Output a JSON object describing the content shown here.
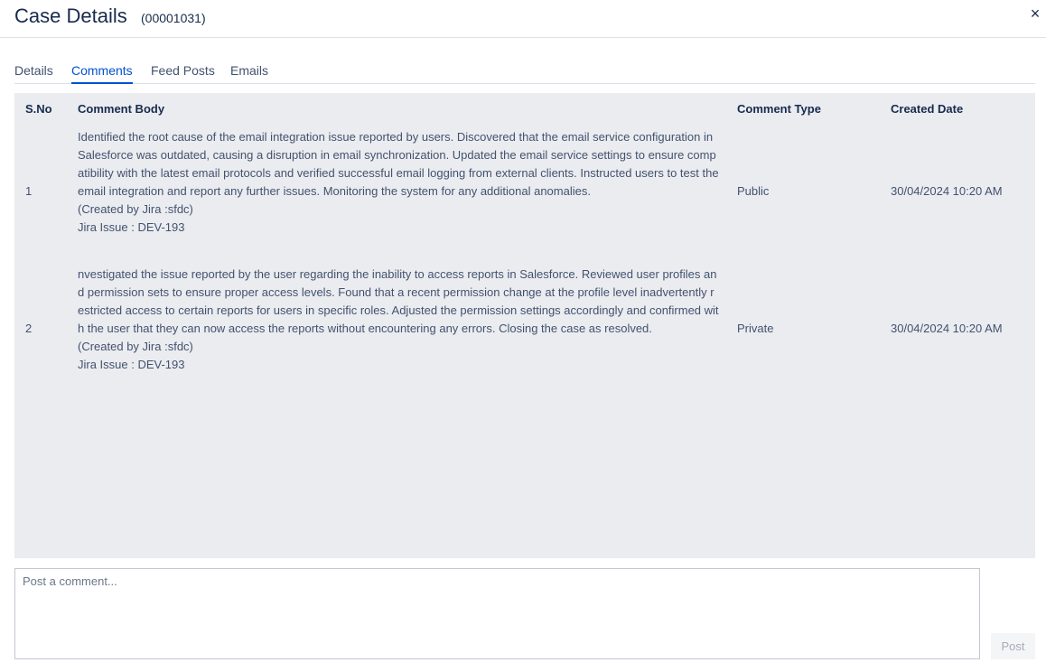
{
  "header": {
    "title": "Case Details",
    "case_number": "(00001031)",
    "close_label": "×"
  },
  "tabs": [
    {
      "label": "Details",
      "active": false
    },
    {
      "label": "Comments",
      "active": true
    },
    {
      "label": "Feed Posts",
      "active": false
    },
    {
      "label": "Emails",
      "active": false
    }
  ],
  "table": {
    "columns": [
      "S.No",
      "Comment Body",
      "Comment Type",
      "Created Date"
    ],
    "rows": [
      {
        "sno": "1",
        "body": "Identified the root cause of the email integration issue reported by users. Discovered that the email service configuration in Salesforce was outdated, causing a disruption in email synchronization. Updated the email service settings to ensure compatibility with the latest email protocols and verified successful email logging from external clients. Instructed users to test the email integration and report any further issues. Monitoring the system for any additional anomalies.\n(Created by Jira :sfdc)\nJira Issue : DEV-193",
        "type": "Public",
        "date": "30/04/2024 10:20 AM"
      },
      {
        "sno": "2",
        "body": "nvestigated the issue reported by the user regarding the inability to access reports in Salesforce. Reviewed user profiles and permission sets to ensure proper access levels. Found that a recent permission change at the profile level inadvertently restricted access to certain reports for users in specific roles. Adjusted the permission settings accordingly and confirmed with the user that they can now access the reports without encountering any errors. Closing the case as resolved.\n(Created by Jira :sfdc)\nJira Issue : DEV-193",
        "type": "Private",
        "date": "30/04/2024 10:20 AM"
      }
    ]
  },
  "composer": {
    "placeholder": "Post a comment...",
    "value": "",
    "post_label": "Post"
  },
  "colors": {
    "accent": "#0052cc",
    "table_bg": "#ebecf0",
    "text": "#172b4d"
  }
}
